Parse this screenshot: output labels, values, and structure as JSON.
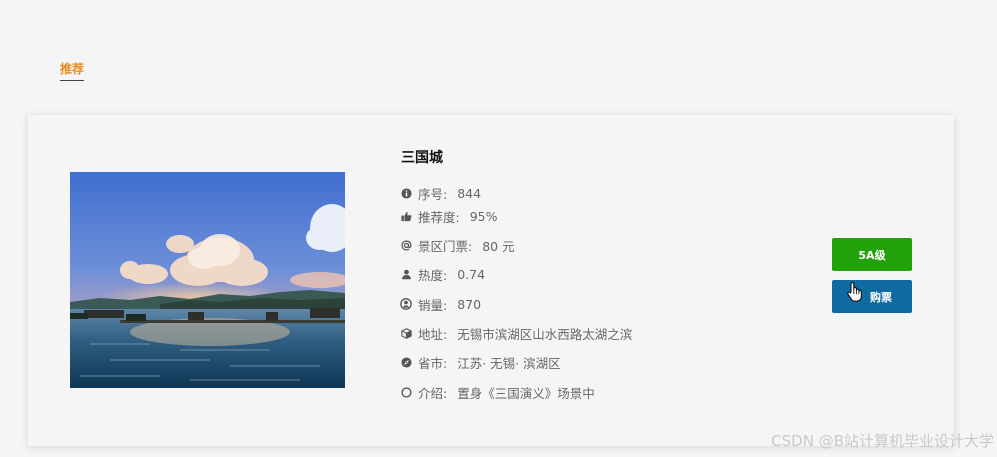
{
  "tab": {
    "label": "推荐"
  },
  "spot": {
    "name": "三国城",
    "rows": [
      {
        "icon": "info-circle-icon",
        "label": "序号:",
        "value": "844"
      },
      {
        "icon": "thumbs-up-icon",
        "label": "推荐度:",
        "value": "95%"
      },
      {
        "icon": "at-sign-icon",
        "label": "景区门票:",
        "value": "80 元"
      },
      {
        "icon": "user-icon",
        "label": "热度:",
        "value": "0.74"
      },
      {
        "icon": "user-circle-icon",
        "label": "销量:",
        "value": "870"
      },
      {
        "icon": "cube-icon",
        "label": "地址:",
        "value": "无锡市滨湖区山水西路太湖之滨"
      },
      {
        "icon": "compass-icon",
        "label": "省市:",
        "value": "江苏· 无锡· 滨湖区"
      },
      {
        "icon": "circle-icon",
        "label": "介绍:",
        "value": "置身《三国演义》场景中"
      }
    ],
    "level_label": "5A级",
    "buy_label": "购票"
  },
  "watermark": "CSDN @B站计算机毕业设计大学",
  "colors": {
    "accent": "#e8891a",
    "level_button": "#22a10a",
    "buy_button": "#0e6aa0"
  }
}
